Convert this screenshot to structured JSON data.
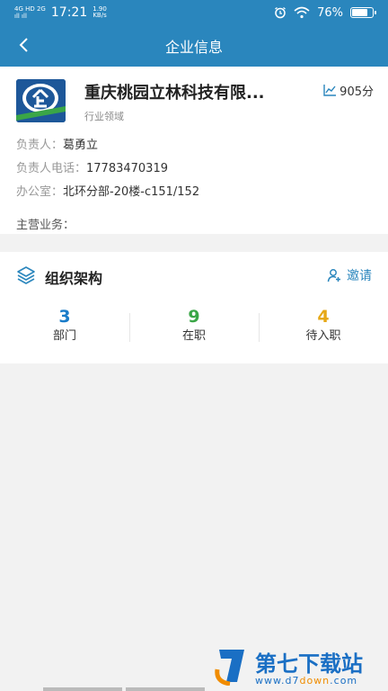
{
  "status_bar": {
    "network_top": "4G HD 2G",
    "network_bottom": "ıll ıll",
    "time": "17:21",
    "speed_value": "1.90",
    "speed_unit": "KB/s",
    "battery_percent": "76%",
    "battery_level": 0.76
  },
  "nav": {
    "title": "企业信息"
  },
  "company": {
    "name": "重庆桃园立林科技有限...",
    "score": "905分",
    "industry_label": "行业领域",
    "manager_label": "负责人：",
    "manager": "葛勇立",
    "phone_label": "负责人电话：",
    "phone": "17783470319",
    "office_label": "办公室：",
    "office": "北环分部-20楼-c151/152",
    "business_label": "主营业务："
  },
  "org": {
    "title": "组织架构",
    "invite_label": "邀请",
    "stats": [
      {
        "value": "3",
        "label": "部门",
        "color": "#1a7cc9"
      },
      {
        "value": "9",
        "label": "在职",
        "color": "#3aa647"
      },
      {
        "value": "4",
        "label": "待入职",
        "color": "#e6a817"
      }
    ]
  },
  "watermark": {
    "title": "第七下载站",
    "url_part1": "www.d7",
    "url_part2": "down",
    "url_part3": ".com"
  },
  "colors": {
    "primary": "#2a86bd",
    "background": "#f2f2f2"
  }
}
